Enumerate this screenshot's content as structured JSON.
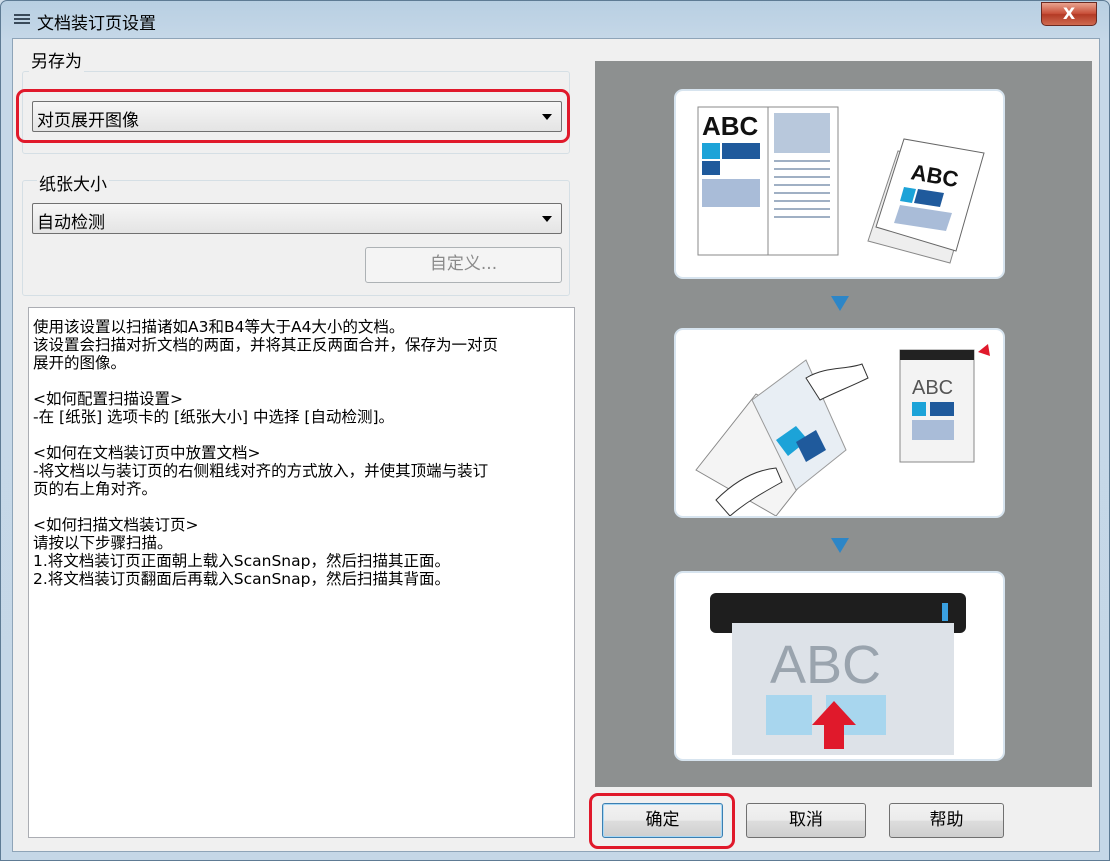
{
  "window": {
    "title": "文档装订页设置",
    "close_glyph": "X"
  },
  "save_as": {
    "label": "另存为",
    "selected": "对页展开图像"
  },
  "paper_size": {
    "label": "纸张大小",
    "selected": "自动检测",
    "custom_button": "自定义..."
  },
  "description": [
    "使用该设置以扫描诸如A3和B4等大于A4大小的文档。",
    "该设置会扫描对折文档的两面，并将其正反两面合并，保存为一对页",
    "展开的图像。",
    "",
    "<如何配置扫描设置>",
    "-在 [纸张] 选项卡的 [纸张大小] 中选择 [自动检测]。",
    "",
    "<如何在文档装订页中放置文档>",
    "-将文档以与装订页的右侧粗线对齐的方式放入，并使其顶端与装订",
    "页的右上角对齐。",
    "",
    "<如何扫描文档装订页>",
    "请按以下步骤扫描。",
    "1.将文档装订页正面朝上载入ScanSnap，然后扫描其正面。",
    "2.将文档装订页翻面后再载入ScanSnap，然后扫描其背面。"
  ],
  "illustration": {
    "abc": "ABC"
  },
  "buttons": {
    "ok": "确定",
    "cancel": "取消",
    "help": "帮助"
  },
  "colors": {
    "accent_blue": "#2d86c7",
    "highlight_red": "#e0192b",
    "panel_gray": "#8d9090"
  }
}
